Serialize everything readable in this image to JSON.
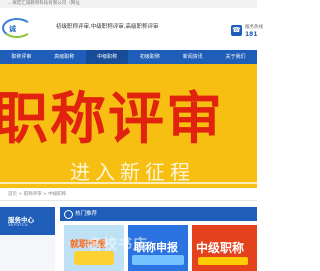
{
  "top_strip": {
    "text": "...保定汇诚教育科技有限公司（网址"
  },
  "header": {
    "logo_text": "诚",
    "tagline": "初级职称评审,中级职称评审,高级职称评审",
    "phone_label": "服务热线",
    "phone_number": "181"
  },
  "nav": {
    "items": [
      "职称评审",
      "高级职称",
      "中级职称",
      "初级职称",
      "新闻资讯",
      "关于我们"
    ]
  },
  "banner": {
    "headline": "职称评审",
    "subline": "进入新征程"
  },
  "breadcrumb": {
    "text": "首页 > 职称评审 > 中级职称"
  },
  "sidebar": {
    "title": "服务中心",
    "subtitle": "SERVICE"
  },
  "recommend": {
    "title": "热门推荐",
    "cards": [
      "就职申报",
      "职称申报",
      "中级职称"
    ],
    "watermark": "名校书店"
  },
  "colors": {
    "primary": "#1e5db8",
    "banner_bg": "#f6bf12",
    "banner_text": "#e0220f"
  }
}
